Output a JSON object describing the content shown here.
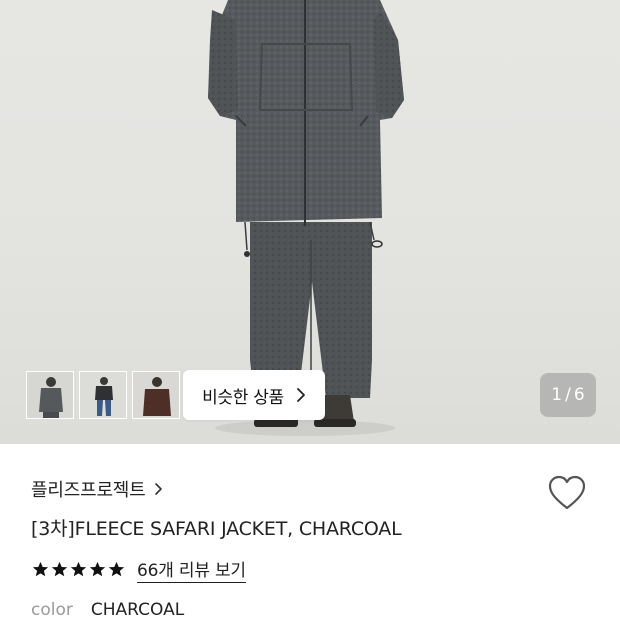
{
  "gallery": {
    "similar_button_label": "비슷한 상품",
    "page_current": "1",
    "page_total": "6",
    "thumbnails": [
      "thumbnail-front",
      "thumbnail-model-2",
      "thumbnail-model-3"
    ]
  },
  "product": {
    "brand": "플리즈프로젝트",
    "title": "[3차]FLEECE SAFARI JACKET, CHARCOAL",
    "rating_stars": 5,
    "review_link": "66개 리뷰 보기",
    "option_label": "color",
    "option_value": "CHARCOAL"
  },
  "colors": {
    "garment": "#55595c",
    "background": "#e4e4e1",
    "star": "#111111"
  },
  "icons": {
    "brand_chevron": "chevron-right-icon",
    "wishlist": "heart-icon",
    "similar_chevron": "chevron-right-icon",
    "rating": "star-icon"
  }
}
